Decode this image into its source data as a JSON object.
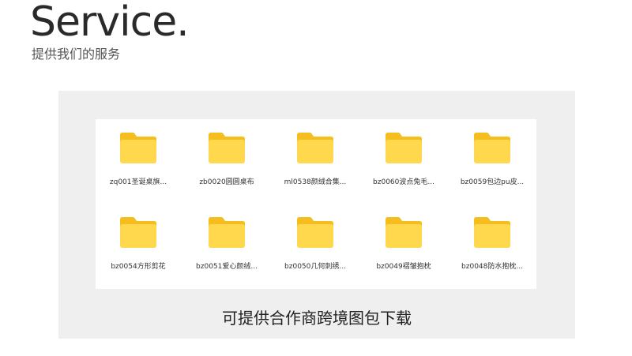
{
  "header": {
    "title": "Service.",
    "subtitle": "提供我们的服务"
  },
  "panel": {
    "caption": "可提供合作商跨境图包下载",
    "folders": [
      {
        "label": "zq001圣诞桌旗...",
        "icon": "folder-icon"
      },
      {
        "label": "zb0020圆圆桌布",
        "icon": "folder-icon"
      },
      {
        "label": "ml0538颜绒合集...",
        "icon": "folder-icon"
      },
      {
        "label": "bz0060波点兔毛...",
        "icon": "folder-icon"
      },
      {
        "label": "bz0059包边pu皮...",
        "icon": "folder-icon"
      },
      {
        "label": "bz0054方形剪花",
        "icon": "folder-icon"
      },
      {
        "label": "bz0051爱心颜绒...",
        "icon": "folder-icon"
      },
      {
        "label": "bz0050几何刺绣...",
        "icon": "folder-icon"
      },
      {
        "label": "bz0049褶皱抱枕",
        "icon": "folder-icon"
      },
      {
        "label": "bz0048防水抱枕...",
        "icon": "folder-icon"
      }
    ]
  },
  "colors": {
    "folder_front": "#FFD84D",
    "folder_back": "#F5BE1E",
    "panel_bg": "#EFEFEF",
    "card_bg": "#FFFFFF"
  }
}
